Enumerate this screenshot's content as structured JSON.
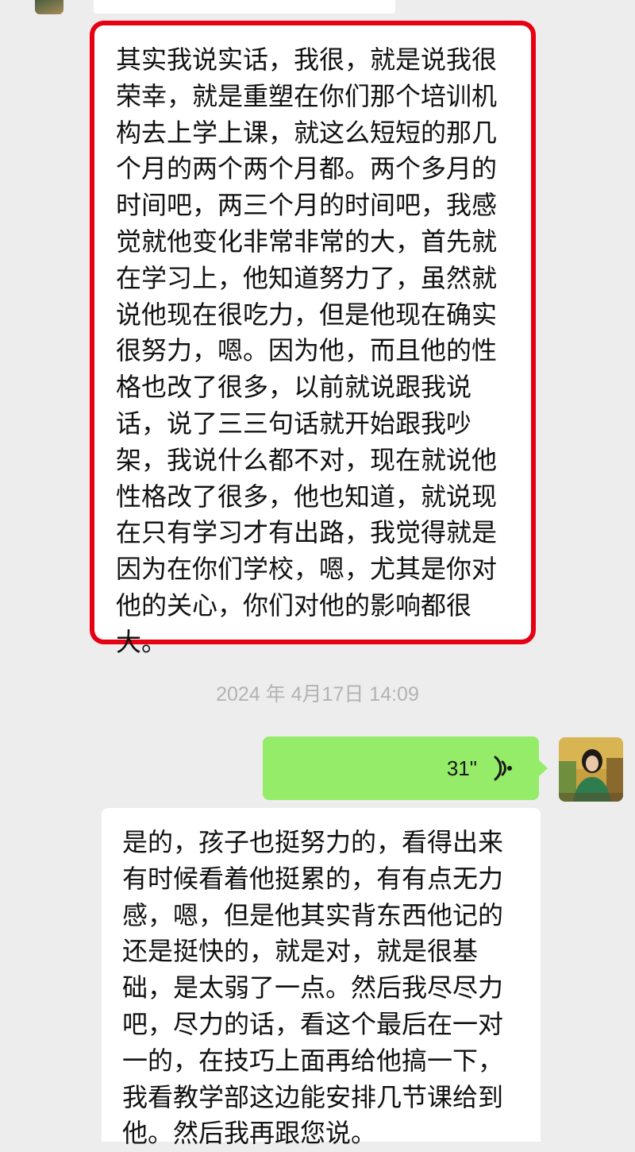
{
  "messages": {
    "highlighted": {
      "lines": [
        "其实我说实话，我很，就是说我很",
        "荣幸，就是重塑在你们那个培训机",
        "构去上学上课，就这么短短的那几",
        "个月的两个两个月都。两个多月的",
        "时间吧，两三个月的时间吧，我感",
        "觉就他变化非常非常的大，首先就",
        "在学习上，他知道努力了，虽然就",
        "说他现在很吃力，但是他现在确实",
        "很努力，嗯。因为他，而且他的性",
        "格也改了很多，以前就说跟我说",
        "话，说了三三句话就开始跟我吵",
        "架，我说什么都不对，现在就说他",
        "性格改了很多，他也知道，就说现",
        "在只有学习才有出路，我觉得就是",
        "因为在你们学校，嗯，尤其是你对",
        "他的关心，你们对他的影响都很",
        "大。"
      ],
      "border_color": "#e60012"
    },
    "timestamp": "2024 年 4月17日 14:09",
    "voice": {
      "duration": "31\"",
      "icon": "voice-wave-icon",
      "bubble_color": "#95ec69"
    },
    "reply": {
      "lines": [
        "是的，孩子也挺努力的，看得出来",
        "有时候看着他挺累的，有有点无力",
        "感，嗯，但是他其实背东西他记的",
        "还是挺快的，就是对，就是很基",
        "础，是太弱了一点。然后我尽尽力",
        "吧，尽力的话，看这个最后在一对",
        "一的，在技巧上面再给他搞一下，",
        "我看教学部这边能安排几节课给到",
        "他。然后我再跟您说。"
      ]
    }
  },
  "colors": {
    "background": "#ededed",
    "bubble_white": "#ffffff"
  }
}
